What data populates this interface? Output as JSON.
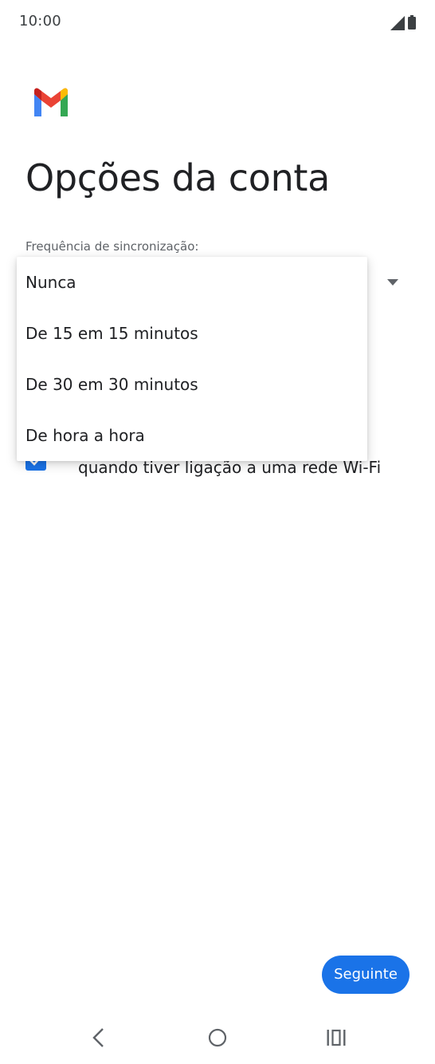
{
  "status_bar": {
    "time": "10:00",
    "icons": [
      "signal-icon",
      "battery-icon"
    ]
  },
  "header": {
    "logo": "gmail-logo-icon",
    "title": "Opções da conta"
  },
  "sync": {
    "label": "Frequência de sincronização:",
    "selected": "",
    "options": [
      "Nunca",
      "De 15 em 15 minutos",
      "De 30 em 30 minutos",
      "De hora a hora"
    ]
  },
  "wifi_option": {
    "checked": true,
    "label": "quando tiver ligação a uma rede Wi-Fi"
  },
  "footer": {
    "next_label": "Seguinte"
  },
  "nav_bar": {
    "buttons": [
      "back-icon",
      "home-icon",
      "recents-icon"
    ]
  },
  "colors": {
    "accent": "#1a73e8",
    "text": "#202124",
    "secondary_text": "#5f6368"
  }
}
